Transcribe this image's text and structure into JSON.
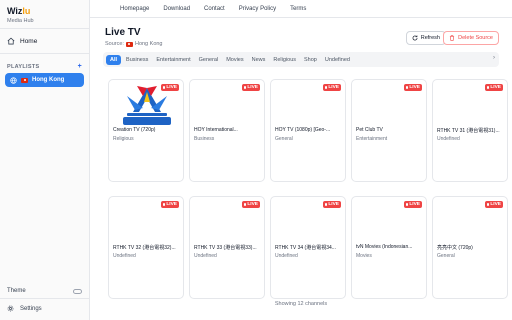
{
  "brand": {
    "name_prefix": "Wiz",
    "name_suffix": "lu",
    "subtitle": "Media Hub"
  },
  "sidebar": {
    "home_label": "Home",
    "playlists_heading": "PLAYLISTS",
    "add_symbol": "+",
    "playlists": [
      {
        "label": "Hong Kong",
        "active": true
      }
    ],
    "theme_label": "Theme",
    "settings_label": "Settings"
  },
  "topnav": {
    "items": [
      "Homepage",
      "Download",
      "Contact",
      "Privacy Policy",
      "Terms"
    ]
  },
  "header": {
    "title": "Live TV",
    "source_prefix": "Source:",
    "source_name": "Hong Kong",
    "refresh_label": "Refresh",
    "delete_label": "Delete Source"
  },
  "categories": {
    "items": [
      "All",
      "Business",
      "Entertainment",
      "General",
      "Movies",
      "News",
      "Religious",
      "Shop",
      "Undefined"
    ],
    "selected": "All"
  },
  "live_badge": "LIVE",
  "channels": [
    {
      "name": "Creation TV (720p)",
      "category": "Religious",
      "logo_text": "創世電視",
      "logo_caption": "CREATION TV"
    },
    {
      "name": "HOY International...",
      "category": "Business"
    },
    {
      "name": "HOY TV (1080p) [Geo-...",
      "category": "General"
    },
    {
      "name": "Pet Club TV",
      "category": "Entertainment"
    },
    {
      "name": "RTHK TV 31 (港台電視31)...",
      "category": "Undefined"
    },
    {
      "name": "RTHK TV 32 (港台電視32)...",
      "category": "Undefined"
    },
    {
      "name": "RTHK TV 33 (港台電視33)...",
      "category": "Undefined"
    },
    {
      "name": "RTHK TV 34 (港台電視34...",
      "category": "Undefined"
    },
    {
      "name": "tvN Movies (Indonesian...",
      "category": "Movies"
    },
    {
      "name": "亮亮中文 (720p)",
      "category": "General"
    }
  ],
  "footer": {
    "status": "Showing 12 channels"
  },
  "colors": {
    "accent": "#2f80ed",
    "live": "#ef4444",
    "delete": "#ef4444",
    "brand_accent": "#f59e0b"
  }
}
